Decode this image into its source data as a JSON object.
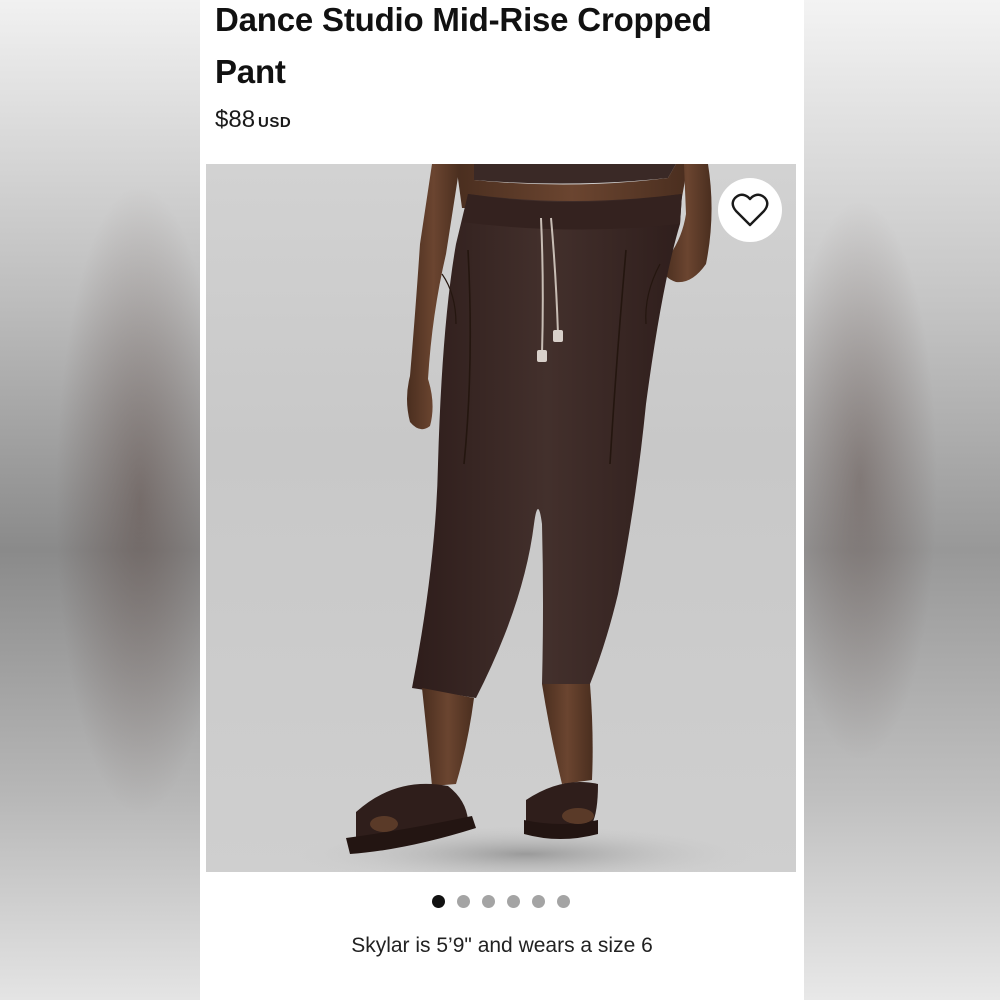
{
  "product": {
    "title": "Dance Studio Mid-Rise Cropped Pant",
    "price": "$88",
    "currency": "USD",
    "colors": {
      "garment": "#3b2623",
      "background": "#cbcbcb",
      "skin": "#5a3a28"
    }
  },
  "gallery": {
    "image_count": 6,
    "active_index": 0,
    "wishlist_icon": "heart-icon",
    "dot_colors": {
      "active": "#111111",
      "inactive": "#a4a4a4"
    }
  },
  "model_info": {
    "caption": "Skylar is 5’9\" and wears a size 6"
  }
}
